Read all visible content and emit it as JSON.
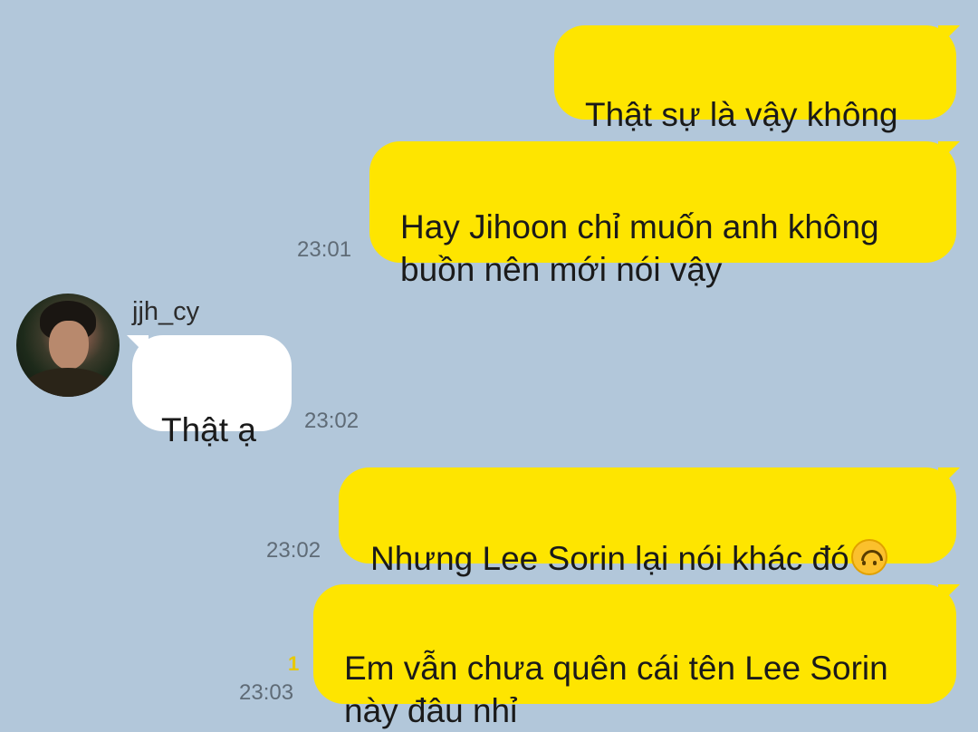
{
  "contact": {
    "name": "jjh_cy"
  },
  "messages": [
    {
      "sender": "me",
      "text": "Thật sự là vậy không"
    },
    {
      "sender": "me",
      "text": "Hay Jihoon chỉ muốn anh không\nbuồn nên mới nói vậy",
      "time": "23:01"
    },
    {
      "sender": "them",
      "text": "Thật ạ",
      "time": "23:02"
    },
    {
      "sender": "me",
      "text": "Nhưng Lee Sorin lại nói khác đó",
      "emoji": "upside-down-face-icon",
      "time": "23:02"
    },
    {
      "sender": "me",
      "text": "Em vẫn chưa quên cái tên Lee Sorin\nnày đâu nhỉ",
      "time": "23:03",
      "unread": "1"
    }
  ],
  "colors": {
    "background": "#b2c7da",
    "my_bubble": "#fee500",
    "their_bubble": "#ffffff",
    "unread": "#e8c800"
  }
}
